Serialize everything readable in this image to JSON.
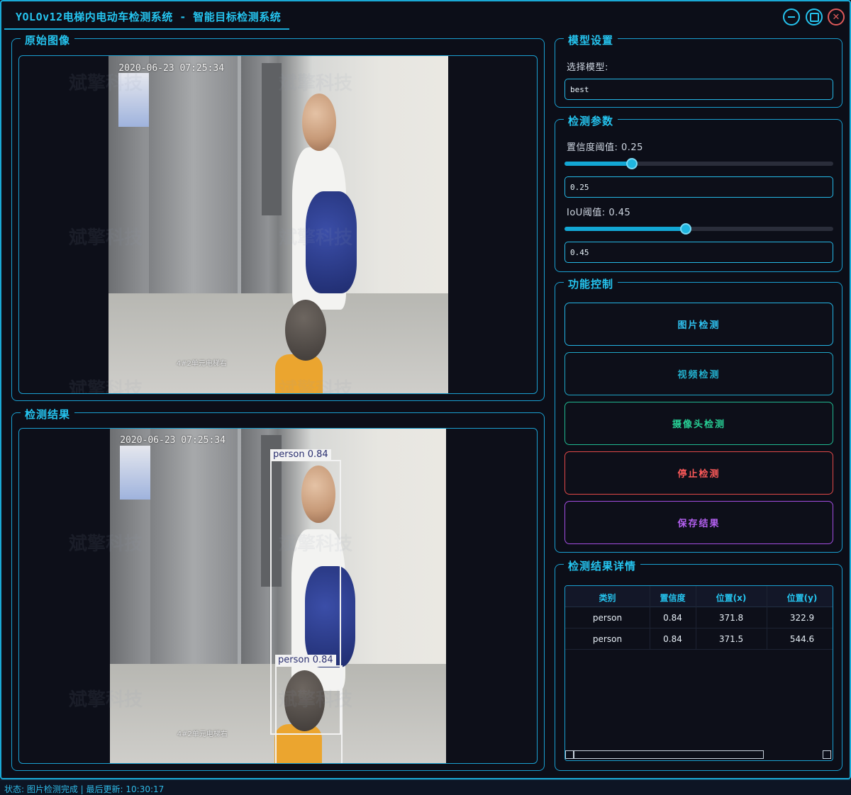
{
  "window": {
    "title": "YOLOv12电梯内电动车检测系统 - 智能目标检测系统"
  },
  "panels": {
    "original": {
      "title": "原始图像"
    },
    "result": {
      "title": "检测结果"
    },
    "model": {
      "title": "模型设置",
      "select_label": "选择模型:",
      "selected_model": "best"
    },
    "params": {
      "title": "检测参数",
      "confidence_label": "置信度阈值: 0.25",
      "confidence_value": "0.25",
      "confidence": 0.25,
      "iou_label": "IoU阈值: 0.45",
      "iou_value": "0.45",
      "iou": 0.45
    },
    "controls": {
      "title": "功能控制",
      "image_detect": "图片检测",
      "video_detect": "视频检测",
      "camera_detect": "摄像头检测",
      "stop_detect": "停止检测",
      "save_result": "保存结果"
    },
    "details": {
      "title": "检测结果详情",
      "columns": [
        "类别",
        "置信度",
        "位置(x)",
        "位置(y)"
      ],
      "rows": [
        [
          "person",
          "0.84",
          "371.8",
          "322.9"
        ],
        [
          "person",
          "0.84",
          "371.5",
          "544.6"
        ]
      ]
    }
  },
  "image": {
    "timestamp": "2020-06-23 07:25:34",
    "caption": "4#2单元电梯右",
    "watermark": "斌擎科技"
  },
  "detections": [
    {
      "label": "person 0.84"
    },
    {
      "label": "person 0.84"
    }
  ],
  "status": {
    "text": "状态: 图片检测完成 | 最后更新: 10:30:17"
  },
  "colors": {
    "accent": "#25c4ef",
    "stop": "#ff5a5a",
    "save": "#b360f0",
    "camera": "#27cf95"
  }
}
